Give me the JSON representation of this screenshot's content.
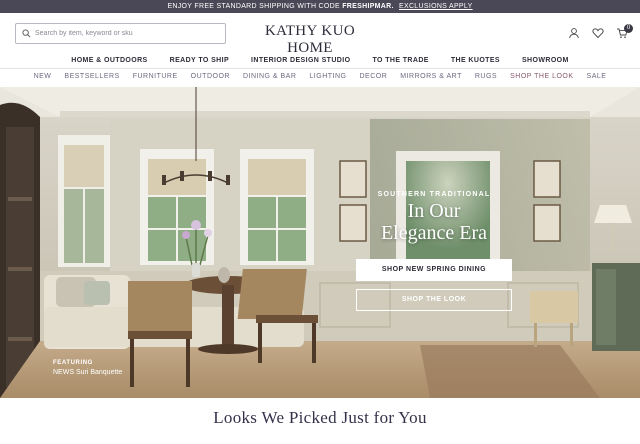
{
  "promo": {
    "text": "ENJOY FREE STANDARD SHIPPING WITH CODE",
    "code": "FRESHIPMAR.",
    "link": "EXCLUSIONS APPLY"
  },
  "header": {
    "search_placeholder": "Search by item, keyword or sku",
    "logo": "KATHY KUO HOME",
    "cart_count": "0"
  },
  "main_nav": [
    {
      "label": "HOME & OUTDOORS"
    },
    {
      "label": "READY TO SHIP"
    },
    {
      "label": "INTERIOR DESIGN STUDIO"
    },
    {
      "label": "TO THE TRADE"
    },
    {
      "label": "THE KUOTES"
    },
    {
      "label": "SHOWROOM"
    }
  ],
  "sub_nav": [
    {
      "label": "NEW"
    },
    {
      "label": "BESTSELLERS"
    },
    {
      "label": "FURNITURE"
    },
    {
      "label": "OUTDOOR"
    },
    {
      "label": "DINING & BAR"
    },
    {
      "label": "LIGHTING"
    },
    {
      "label": "DECOR"
    },
    {
      "label": "MIRRORS & ART"
    },
    {
      "label": "RUGS"
    },
    {
      "label": "SHOP THE LOOK"
    },
    {
      "label": "SALE"
    }
  ],
  "hero": {
    "eyebrow": "SOUTHERN TRADITIONAL",
    "headline_line1": "In Our",
    "headline_line2": "Elegance Era",
    "primary_cta": "SHOP NEW SPRING DINING",
    "secondary_cta": "SHOP THE LOOK",
    "featuring_label": "FEATURING",
    "featuring_product": "NEWS Suri Banquette"
  },
  "section": {
    "title": "Looks We Picked Just for You"
  },
  "colors": {
    "promo_bg": "#4a4856",
    "text_dark": "#2b2b3a",
    "subnav_text": "#6d6a80",
    "accent_mauve": "#8a5a6e"
  }
}
